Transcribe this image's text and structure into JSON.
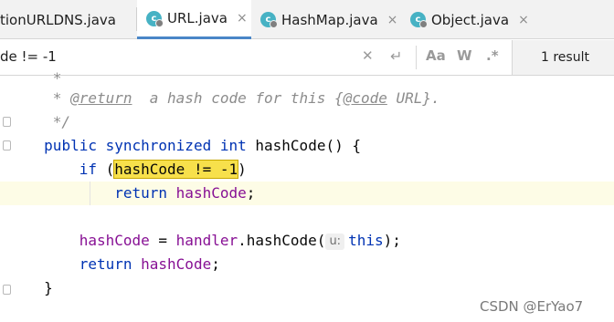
{
  "tabs": [
    {
      "label": "tionURLDNS.java",
      "icon": "none",
      "active": false
    },
    {
      "label": "URL.java",
      "icon": "class-icon",
      "active": true
    },
    {
      "label": "HashMap.java",
      "icon": "class-icon",
      "active": false
    },
    {
      "label": "Object.java",
      "icon": "class-icon",
      "active": false
    }
  ],
  "tab_close_glyph": "×",
  "find": {
    "query": "de != -1",
    "case_label": "Aa",
    "word_label": "W",
    "regex_label": ".*",
    "result": "1 result"
  },
  "code": {
    "l1": "*",
    "l2_tag": "@return",
    "l2_text": "a hash code for this {",
    "l2_code": "@code",
    "l2_end": " URL}.",
    "l3": "*/",
    "l4_public": "public",
    "l4_sync": "synchronized",
    "l4_int": "int",
    "l4_rest": "hashCode() {",
    "l5_if": "if",
    "l5_open": "(",
    "l5_match": "hashCode != -1",
    "l5_close": ")",
    "l6_return": "return",
    "l6_field": "hashCode",
    "l6_semi": ";",
    "l8_field": "hashCode",
    "l8_mid": " = ",
    "l8_handler": "handler",
    "l8_call": ".hashCode(",
    "l8_hint": "u:",
    "l8_this": "this",
    "l8_end": ");",
    "l9_return": "return",
    "l9_field": "hashCode",
    "l9_semi": ";",
    "l10": "}"
  },
  "watermark": "CSDN @ErYao7",
  "colors": {
    "keyword": "#0033b3",
    "field": "#871094",
    "comment": "#8c8c8c",
    "match_highlight": "#f7e04b",
    "tab_underline": "#4a86c7",
    "class_icon": "#47b2c4"
  }
}
